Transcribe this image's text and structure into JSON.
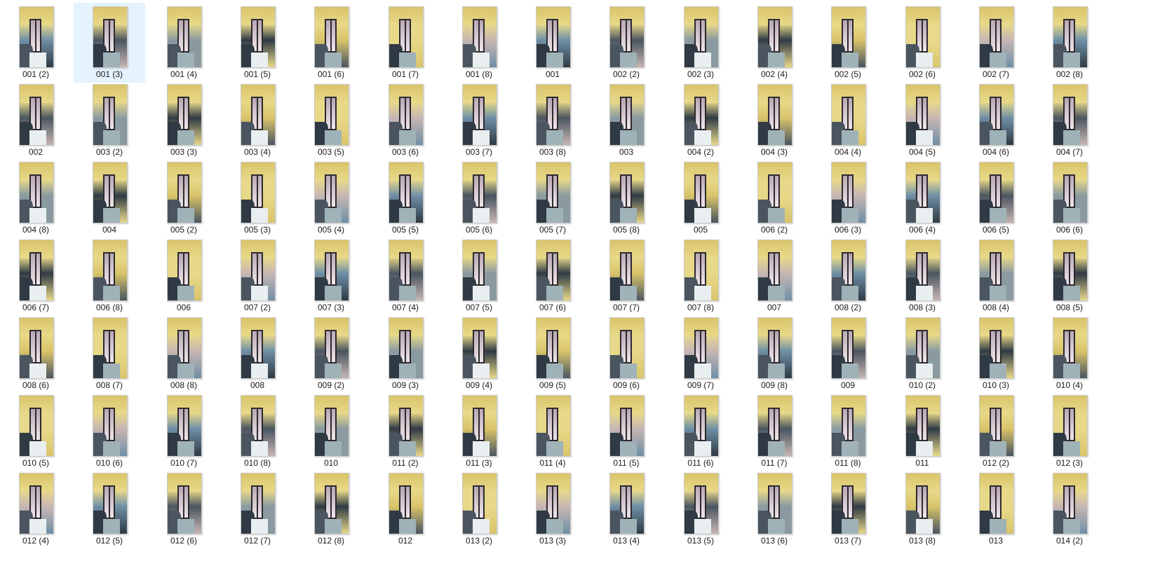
{
  "explorer": {
    "selected_index": 1,
    "files": [
      "001 (2)",
      "001 (3)",
      "001 (4)",
      "001 (5)",
      "001 (6)",
      "001 (7)",
      "001 (8)",
      "001",
      "002 (2)",
      "002 (3)",
      "002 (4)",
      "002 (5)",
      "002 (6)",
      "002 (7)",
      "002 (8)",
      "002",
      "003 (2)",
      "003 (3)",
      "003 (4)",
      "003 (5)",
      "003 (6)",
      "003 (7)",
      "003 (8)",
      "003",
      "004 (2)",
      "004 (3)",
      "004 (4)",
      "004 (5)",
      "004 (6)",
      "004 (7)",
      "004 (8)",
      "004",
      "005 (2)",
      "005 (3)",
      "005 (4)",
      "005 (5)",
      "005 (6)",
      "005 (7)",
      "005 (8)",
      "005",
      "006 (2)",
      "006 (3)",
      "006 (4)",
      "006 (5)",
      "006 (6)",
      "006 (7)",
      "006 (8)",
      "006",
      "007 (2)",
      "007 (3)",
      "007 (4)",
      "007 (5)",
      "007 (6)",
      "007 (7)",
      "007 (8)",
      "007",
      "008 (2)",
      "008 (3)",
      "008 (4)",
      "008 (5)",
      "008 (6)",
      "008 (7)",
      "008 (8)",
      "008",
      "009 (2)",
      "009 (3)",
      "009 (4)",
      "009 (5)",
      "009 (6)",
      "009 (7)",
      "009 (8)",
      "009",
      "010 (2)",
      "010 (3)",
      "010 (4)",
      "010 (5)",
      "010 (6)",
      "010 (7)",
      "010 (8)",
      "010",
      "011 (2)",
      "011 (3)",
      "011 (4)",
      "011 (5)",
      "011 (6)",
      "011 (7)",
      "011 (8)",
      "011",
      "012 (2)",
      "012 (3)",
      "012 (4)",
      "012 (5)",
      "012 (6)",
      "012 (7)",
      "012 (8)",
      "012",
      "013 (2)",
      "013 (3)",
      "013 (4)",
      "013 (5)",
      "013 (6)",
      "013 (7)",
      "013 (8)",
      "013",
      "014 (2)"
    ]
  },
  "colors": {
    "selection_bg": "#e5f3ff",
    "label_text": "#1a1a1a",
    "thumb_palette": [
      "#d9c46a",
      "#6f8fa6",
      "#2f3a44",
      "#c7b6b3",
      "#8a9aa0",
      "#e8d98a",
      "#4a5560"
    ]
  }
}
